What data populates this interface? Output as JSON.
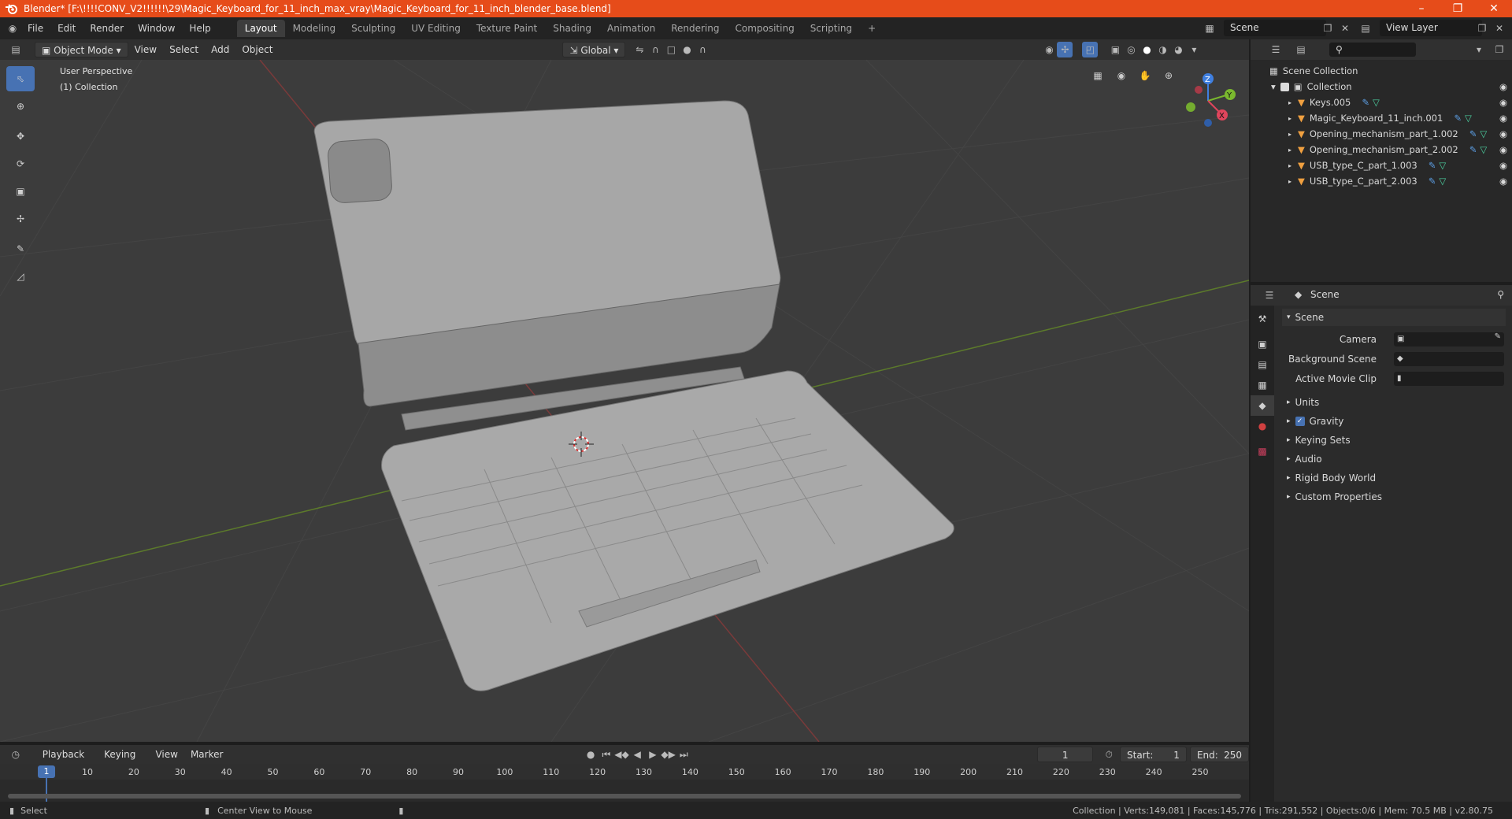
{
  "window": {
    "title": "Blender* [F:\\!!!!CONV_V2!!!!!!\\29\\Magic_Keyboard_for_11_inch_max_vray\\Magic_Keyboard_for_11_inch_blender_base.blend]",
    "accent": "#e64c1a"
  },
  "menus": [
    "File",
    "Edit",
    "Render",
    "Window",
    "Help"
  ],
  "workspaces": [
    "Layout",
    "Modeling",
    "Sculpting",
    "UV Editing",
    "Texture Paint",
    "Shading",
    "Animation",
    "Rendering",
    "Compositing",
    "Scripting"
  ],
  "active_workspace": "Layout",
  "scene_name": "Scene",
  "view_layer": "View Layer",
  "viewport": {
    "mode": "Object Mode",
    "menus": [
      "View",
      "Select",
      "Add",
      "Object"
    ],
    "orientation": "Global",
    "perspective": "User Perspective",
    "collection_label": "(1) Collection",
    "gizmo": {
      "x": "X",
      "y": "Y",
      "z": "Z"
    }
  },
  "outliner": {
    "root": "Scene Collection",
    "collection": "Collection",
    "items": [
      "Keys.005",
      "Magic_Keyboard_11_inch.001",
      "Opening_mechanism_part_1.002",
      "Opening_mechanism_part_2.002",
      "USB_type_C_part_1.003",
      "USB_type_C_part_2.003"
    ]
  },
  "properties": {
    "header": "Scene",
    "section": "Scene",
    "fields": [
      "Camera",
      "Background Scene",
      "Active Movie Clip"
    ],
    "panels": [
      "Units",
      "Gravity",
      "Keying Sets",
      "Audio",
      "Rigid Body World",
      "Custom Properties"
    ]
  },
  "timeline": {
    "menus": [
      "Playback",
      "Keying",
      "View",
      "Marker"
    ],
    "current_frame": "1",
    "start_label": "Start:",
    "start": "1",
    "end_label": "End:",
    "end": "250",
    "ticks": [
      "1",
      "10",
      "20",
      "30",
      "40",
      "50",
      "60",
      "70",
      "80",
      "90",
      "100",
      "110",
      "120",
      "130",
      "140",
      "150",
      "160",
      "170",
      "180",
      "190",
      "200",
      "210",
      "220",
      "230",
      "240",
      "250"
    ]
  },
  "status": {
    "left": "Select",
    "middle": "Center View to Mouse",
    "right": "Collection | Verts:149,081 | Faces:145,776 | Tris:291,552 | Objects:0/6 | Mem: 70.5 MB | v2.80.75"
  }
}
